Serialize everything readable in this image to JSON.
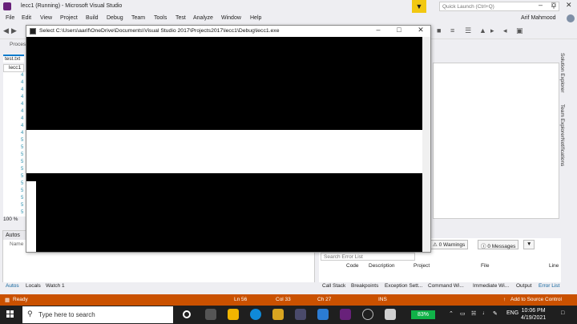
{
  "vs": {
    "title": "lecc1 (Running) - Microsoft Visual Studio",
    "quick_launch_placeholder": "Quick Launch (Ctrl+Q)",
    "menu": [
      "File",
      "Edit",
      "View",
      "Project",
      "Build",
      "Debug",
      "Team",
      "Tools",
      "Test",
      "Analyze",
      "Window",
      "Help"
    ],
    "user": "Arif Mahmood",
    "process_label": "Proces",
    "doc_tab": "test.txt",
    "nav_dropdown": "lecc1",
    "line_numbers": [
      "4",
      "4",
      "4",
      "4",
      "4",
      "4",
      "4",
      "4",
      "4",
      "5",
      "5",
      "5",
      "5",
      "5",
      "5",
      "5",
      "5",
      "5",
      "5",
      "5"
    ],
    "zoom": "100 %",
    "autos": {
      "title": "Autos",
      "name_col": "Name"
    },
    "bottom_tabs": [
      "Autos",
      "Locals",
      "Watch 1"
    ],
    "error_list": {
      "warnings": "0 Warnings",
      "messages": "0 Messages",
      "search_placeholder": "Search Error List",
      "columns": [
        "Code",
        "Description",
        "Project",
        "File",
        "Line"
      ]
    },
    "error_tabs": [
      "Call Stack",
      "Breakpoints",
      "Exception Sett...",
      "Command Wi...",
      "Immediate Wi...",
      "Output",
      "Error List"
    ],
    "side_tabs": [
      "Solution Explorer",
      "Team Explorer",
      "Notifications"
    ],
    "status": {
      "ready": "Ready",
      "ln": "Ln 56",
      "col": "Col 33",
      "ch": "Ch 27",
      "ins": "INS",
      "source_control": "Add to Source Control"
    }
  },
  "console": {
    "title": "Select C:\\Users\\aarif\\OneDrive\\Documents\\Visual Studio 2017\\Projects2017\\lecc1\\Debug\\lecc1.exe"
  },
  "taskbar": {
    "search_placeholder": "Type here to search",
    "battery": "83%",
    "language": "ENG",
    "time": "10:06 PM",
    "date": "4/19/2021"
  }
}
